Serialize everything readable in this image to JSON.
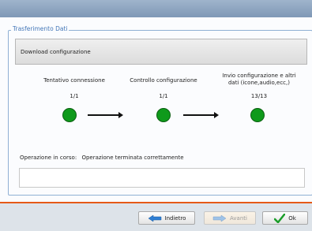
{
  "window": {
    "group_title": "Trasferimento Dati"
  },
  "section": {
    "title": "Download configurazione"
  },
  "steps": [
    {
      "label": "Tentativo connessione",
      "count": "1/1",
      "status": "done"
    },
    {
      "label": "Controllo configurazione",
      "count": "1/1",
      "status": "done"
    },
    {
      "label_line1": "Invio configurazione e altri",
      "label_line2": "dati (icone,audio,ecc,)",
      "count": "13/13",
      "status": "done"
    }
  ],
  "operation": {
    "label": "Operazione in corso:",
    "value": "Operazione terminata correttamente",
    "log": ""
  },
  "buttons": {
    "back": "Indietro",
    "next": "Avanti",
    "ok": "Ok"
  },
  "colors": {
    "accent": "#e55a18",
    "success": "#0f9a1b",
    "group_border": "#8fb0d4"
  },
  "icons": {
    "back": "arrow-left-icon",
    "next": "arrow-right-icon",
    "ok": "checkmark-icon"
  }
}
